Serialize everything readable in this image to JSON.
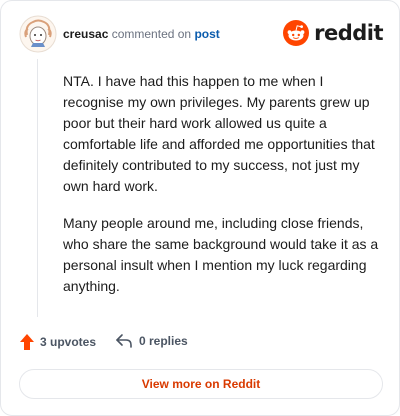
{
  "header": {
    "username": "creusac",
    "verb": "commented on",
    "link_text": "post",
    "brand_wordmark": "reddit",
    "avatar_icon": "avatar-icon",
    "brand_icon": "reddit-alien-icon"
  },
  "comment": {
    "paragraphs": [
      "NTA. I have had this happen to me when I recognise my own privileges. My parents grew up poor but their hard work allowed us quite a comfortable life and afforded me opportunities that definitely contributed to my success, not just my own hard work.",
      "Many people around me, including close friends, who share the same background would take it as a personal insult when I mention my luck regarding anything."
    ]
  },
  "footer": {
    "upvotes": "3 upvotes",
    "replies": "0 replies",
    "upvote_icon": "upvote-arrow-icon",
    "reply_icon": "reply-arrow-icon"
  },
  "cta": {
    "label": "View more on Reddit"
  },
  "colors": {
    "brand": "#ff4500",
    "link": "#0b5cad",
    "cta_text": "#d93a00",
    "border": "#e5e7eb"
  }
}
